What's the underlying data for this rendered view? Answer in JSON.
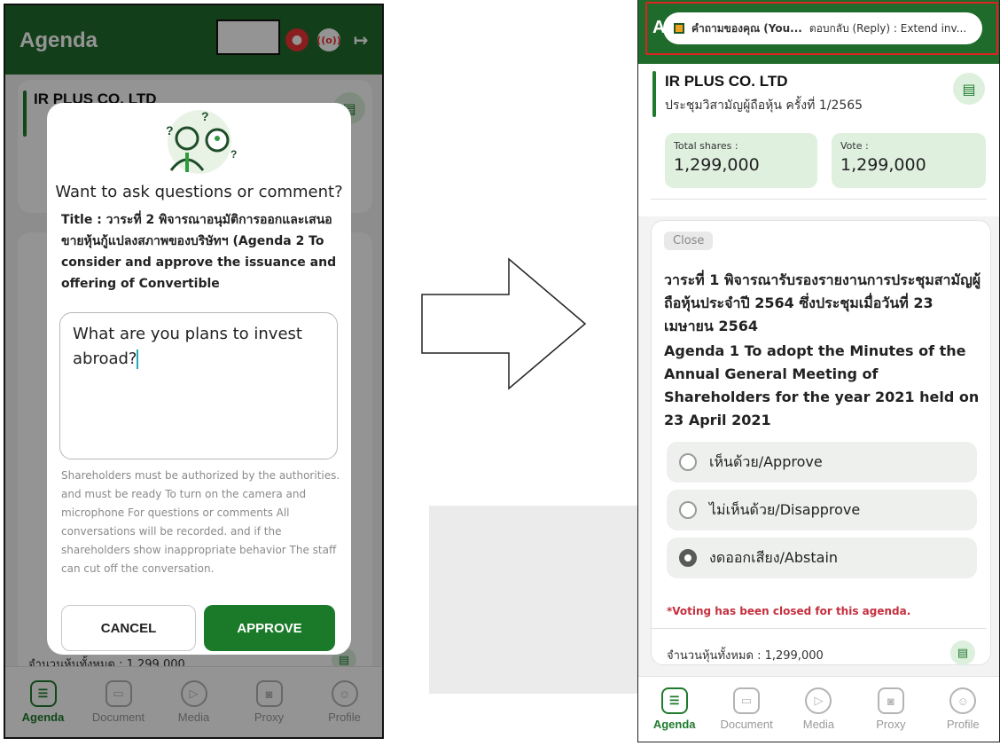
{
  "left": {
    "header_title": "Agenda",
    "company": "IR PLUS CO. LTD",
    "modal": {
      "heading": "Want to ask questions or comment?",
      "title_text": "Title : วาระที่ 2 พิจารณาอนุมัติการออกและเสนอขายหุ้นกู้แปลงสภาพของบริษัทฯ (Agenda 2 To consider and approve the issuance and offering of Convertible",
      "question_value": "What are you plans to invest abroad?",
      "notice": "Shareholders must be authorized by the authorities. and must be ready To turn on the camera and microphone For questions or comments All conversations will be recorded. and if the shareholders show inappropriate behavior The staff can cut off the conversation.",
      "cancel_label": "CANCEL",
      "approve_label": "APPROVE"
    },
    "total_shares_footer": "จำนวนหุ้นทั้งหมด : 1,299,000",
    "nav": [
      "Agenda",
      "Document",
      "Media",
      "Proxy",
      "Profile"
    ]
  },
  "right": {
    "header_letter": "A",
    "notification": {
      "sender": "คำถามของคุณ (You...",
      "message": "ตอบกลับ (Reply) : Extend inv..."
    },
    "company": "IR PLUS CO. LTD",
    "meeting": "ประชุมวิสามัญผู้ถือหุ้น ครั้งที่ 1/2565",
    "stats": {
      "total_label": "Total shares :",
      "total_value": "1,299,000",
      "vote_label": "Vote :",
      "vote_value": "1,299,000"
    },
    "agenda": {
      "status": "Close",
      "title_th": "วาระที่ 1 พิจารณารับรองรายงานการประชุมสามัญผู้ถือหุ้นประจำปี 2564 ซึ่งประชุมเมื่อวันที่ 23 เมษายน 2564",
      "title_en": "Agenda 1 To adopt the Minutes of the Annual General Meeting of Shareholders for the year 2021 held on 23 April 2021",
      "options": [
        {
          "label": "เห็นด้วย/Approve",
          "selected": false
        },
        {
          "label": "ไม่เห็นด้วย/Disapprove",
          "selected": false
        },
        {
          "label": "งดออกเสียง/Abstain",
          "selected": true
        }
      ],
      "closed_notice": "*Voting has been closed for this agenda.",
      "total_shares": "จำนวนหุ้นทั้งหมด : 1,299,000"
    },
    "nav": [
      "Agenda",
      "Document",
      "Media",
      "Proxy",
      "Profile"
    ]
  },
  "colors": {
    "brand_green": "#1f6b2b",
    "accent_green": "#1f7a2e",
    "stat_bg": "#dff0df",
    "warning_red": "#c62f3e"
  }
}
